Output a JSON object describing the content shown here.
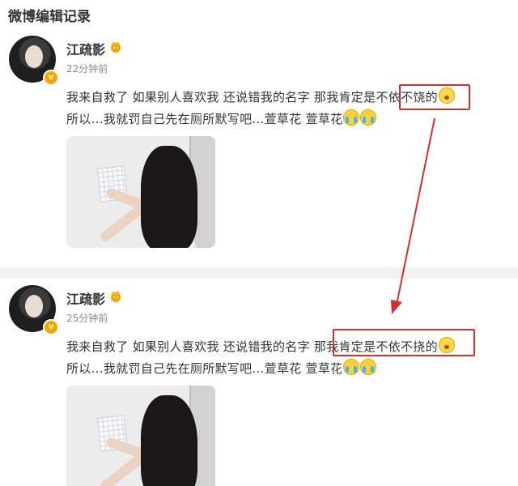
{
  "header": {
    "title": "微博编辑记录"
  },
  "posts": [
    {
      "username": "江疏影",
      "time": "22分钟前",
      "line1_before": "我来自救了 如果别人喜欢我 还说错我的名字 那我肯定是",
      "line1_highlight": "不依不饶",
      "line1_after": "的",
      "line2": "所以...我就罚自己先在厕所默写吧...萱草花 萱草花"
    },
    {
      "username": "江疏影",
      "time": "25分钟前",
      "line1_before": "我来自救了 如果别人喜欢我 还说错我的名字 ",
      "line1_highlight": "那我肯定是不依不挠的",
      "line1_after": "",
      "line2": "所以...我就罚自己先在厕所默写吧...萱草花 萱草花"
    }
  ],
  "colors": {
    "annotation_red": "#d32f2f",
    "verified_badge": "#f7a600",
    "divider": "#f2f2f2"
  },
  "icons": {
    "verified": "v-badge-icon",
    "vip": "vip-crown-icon",
    "emoji_shock": "shocked-face-emoji",
    "emoji_cry": "crying-face-emoji",
    "arrow": "down-arrow-annotation"
  }
}
